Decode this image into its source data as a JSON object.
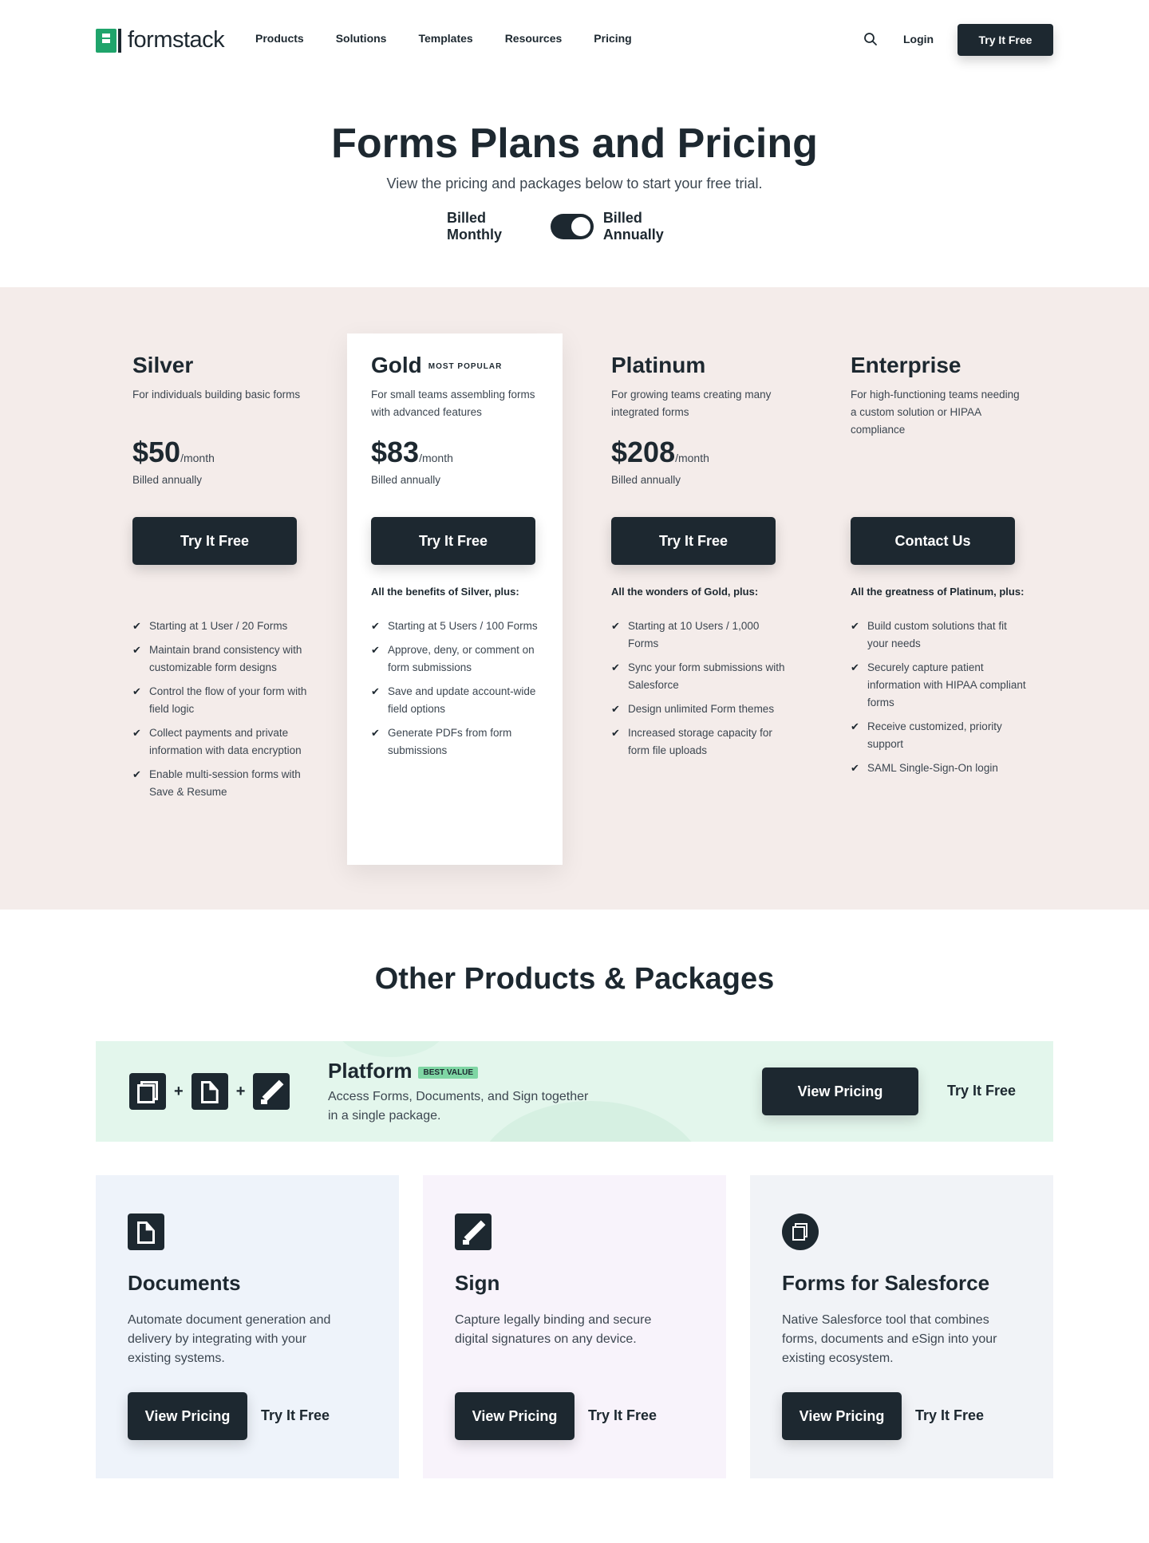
{
  "header": {
    "logo_text": "formstack",
    "nav": [
      "Products",
      "Solutions",
      "Templates",
      "Resources",
      "Pricing"
    ],
    "login": "Login",
    "cta": "Try It Free"
  },
  "hero": {
    "title": "Forms Plans and Pricing",
    "subtitle": "View the pricing and packages below to start your free trial.",
    "billed_monthly": "Billed Monthly",
    "billed_annually": "Billed Annually",
    "toggle_state": "annually"
  },
  "plans": [
    {
      "name": "Silver",
      "badge": "",
      "description": "For individuals building basic forms",
      "price": "$50",
      "period": "/month",
      "billed": "Billed annually",
      "button": "Try It Free",
      "lead": "",
      "features": [
        "Starting at 1 User / 20 Forms",
        "Maintain brand consistency with customizable form designs",
        "Control the flow of your form with field logic",
        "Collect payments and private information with data encryption",
        "Enable multi-session forms with Save & Resume"
      ]
    },
    {
      "name": "Gold",
      "badge": "MOST POPULAR",
      "description": "For small teams assembling forms with advanced features",
      "price": "$83",
      "period": "/month",
      "billed": "Billed annually",
      "button": "Try It Free",
      "lead": "All the benefits of Silver, plus:",
      "features": [
        "Starting at 5 Users / 100 Forms",
        "Approve, deny, or comment on form submissions",
        "Save and update account-wide field options",
        "Generate PDFs from form submissions"
      ]
    },
    {
      "name": "Platinum",
      "badge": "",
      "description": "For growing teams creating many integrated forms",
      "price": "$208",
      "period": "/month",
      "billed": "Billed annually",
      "button": "Try It Free",
      "lead": "All the wonders of Gold, plus:",
      "features": [
        "Starting at 10 Users / 1,000 Forms",
        "Sync your form submissions with Salesforce",
        "Design unlimited Form themes",
        "Increased storage capacity for form file uploads"
      ]
    },
    {
      "name": "Enterprise",
      "badge": "",
      "description": "For high-functioning teams needing a custom solution or HIPAA compliance",
      "price": "",
      "period": "",
      "billed": "",
      "button": "Contact Us",
      "lead": "All the greatness of Platinum, plus:",
      "features": [
        "Build custom solutions that fit your needs",
        "Securely capture patient information with HIPAA compliant forms",
        "Receive customized, priority support",
        "SAML Single-Sign-On login"
      ]
    }
  ],
  "other": {
    "title": "Other Products & Packages",
    "platform": {
      "plus": "+",
      "title": "Platform",
      "badge": "BEST VALUE",
      "description": "Access Forms, Documents, and Sign together in a single package.",
      "view": "View Pricing",
      "try": "Try It Free"
    },
    "products": [
      {
        "title": "Documents",
        "description": "Automate document generation and delivery by integrating with your existing systems.",
        "view": "View Pricing",
        "try": "Try It Free",
        "bg": "#eef3fa"
      },
      {
        "title": "Sign",
        "description": "Capture legally binding and secure digital signatures on any device.",
        "view": "View Pricing",
        "try": "Try It Free",
        "bg": "#f8f3fb"
      },
      {
        "title": "Forms for Salesforce",
        "description": "Native Salesforce tool that combines forms, documents and eSign into your existing ecosystem.",
        "view": "View Pricing",
        "try": "Try It Free",
        "bg": "#f1f3f7"
      }
    ]
  },
  "colors": {
    "brand_green": "#1fa46b",
    "dark": "#1d2830",
    "plans_bg": "#f4ecea",
    "platform_bg": "#e3f6ec"
  }
}
